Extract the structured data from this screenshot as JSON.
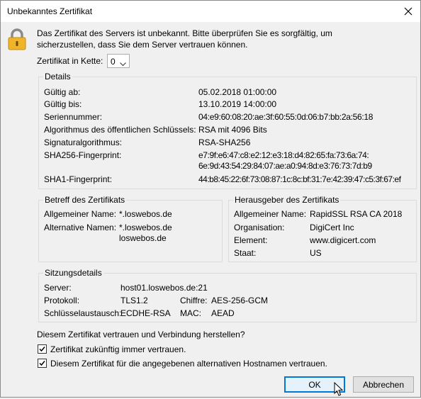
{
  "window": {
    "title": "Unbekanntes Zertifikat"
  },
  "intro_text": "Das Zertifikat des Servers ist unbekannt. Bitte überprüfen Sie es sorgfältig, um sicherzustellen, dass Sie dem Server vertrauen können.",
  "chain": {
    "label": "Zertifikat in Kette:",
    "value": "0"
  },
  "details": {
    "title": "Details",
    "rows": [
      {
        "label": "Gültig ab:",
        "value": "05.02.2018 01:00:00"
      },
      {
        "label": "Gültig bis:",
        "value": "13.10.2019 14:00:00"
      },
      {
        "label": "Seriennummer:",
        "value": "04:e9:60:08:20:ae:3f:60:55:0d:06:b7:bb:2a:56:18"
      },
      {
        "label": "Algorithmus des öffentlichen Schlüssels:",
        "value": "RSA mit 4096 Bits"
      },
      {
        "label": "Signaturalgorithmus:",
        "value": "RSA-SHA256"
      },
      {
        "label": "SHA256-Fingerprint:",
        "value": "e7:9f:e6:47:c8:e2:12:e3:18:d4:82:65:fa:73:6a:74:",
        "value2": "6e:9d:43:54:29:84:07:ae:a0:94:8d:e3:76:73:7d:b9"
      },
      {
        "label": "SHA1-Fingerprint:",
        "value": "44:b8:45:22:6f:73:08:87:1c:8c:bf:31:7e:42:39:47:c5:3f:67:ef"
      }
    ]
  },
  "subject": {
    "title": "Betreff des Zertifikats",
    "common_name_label": "Allgemeiner Name:",
    "common_name": "*.loswebos.de",
    "alt_names_label": "Alternative Namen:",
    "alt_names": [
      "*.loswebos.de",
      "loswebos.de"
    ]
  },
  "issuer": {
    "title": "Herausgeber des Zertifikats",
    "rows": [
      {
        "label": "Allgemeiner Name:",
        "value": "RapidSSL RSA CA 2018"
      },
      {
        "label": "Organisation:",
        "value": "DigiCert Inc"
      },
      {
        "label": "Element:",
        "value": "www.digicert.com"
      },
      {
        "label": "Staat:",
        "value": "US"
      }
    ]
  },
  "session": {
    "title": "Sitzungsdetails",
    "server_label": "Server:",
    "server": "host01.loswebos.de:21",
    "protocol_label": "Protokoll:",
    "protocol": "TLS1.2",
    "cipher_label": "Chiffre:",
    "cipher": "AES-256-GCM",
    "kex_label": "Schlüsselaustausch:",
    "kex": "ECDHE-RSA",
    "mac_label": "MAC:",
    "mac": "AEAD"
  },
  "trust_question": "Diesem Zertifikat vertrauen und Verbindung herstellen?",
  "checkbox_always": {
    "label": "Zertifikat zukünftig immer vertrauen.",
    "checked": true
  },
  "checkbox_alt": {
    "label": "Diesem Zertifikat für die angegebenen alternativen Hostnamen vertrauen.",
    "checked": true
  },
  "buttons": {
    "ok": "OK",
    "cancel": "Abbrechen"
  },
  "icons": {
    "lock": "lock-icon",
    "close": "close-icon",
    "chevron": "chevron-down-icon",
    "check": "checkmark-icon",
    "cursor": "mouse-pointer-icon"
  },
  "colors": {
    "accent": "#0078d7",
    "lock_body": "#f0b429",
    "lock_shackle": "#8a8a8a"
  }
}
